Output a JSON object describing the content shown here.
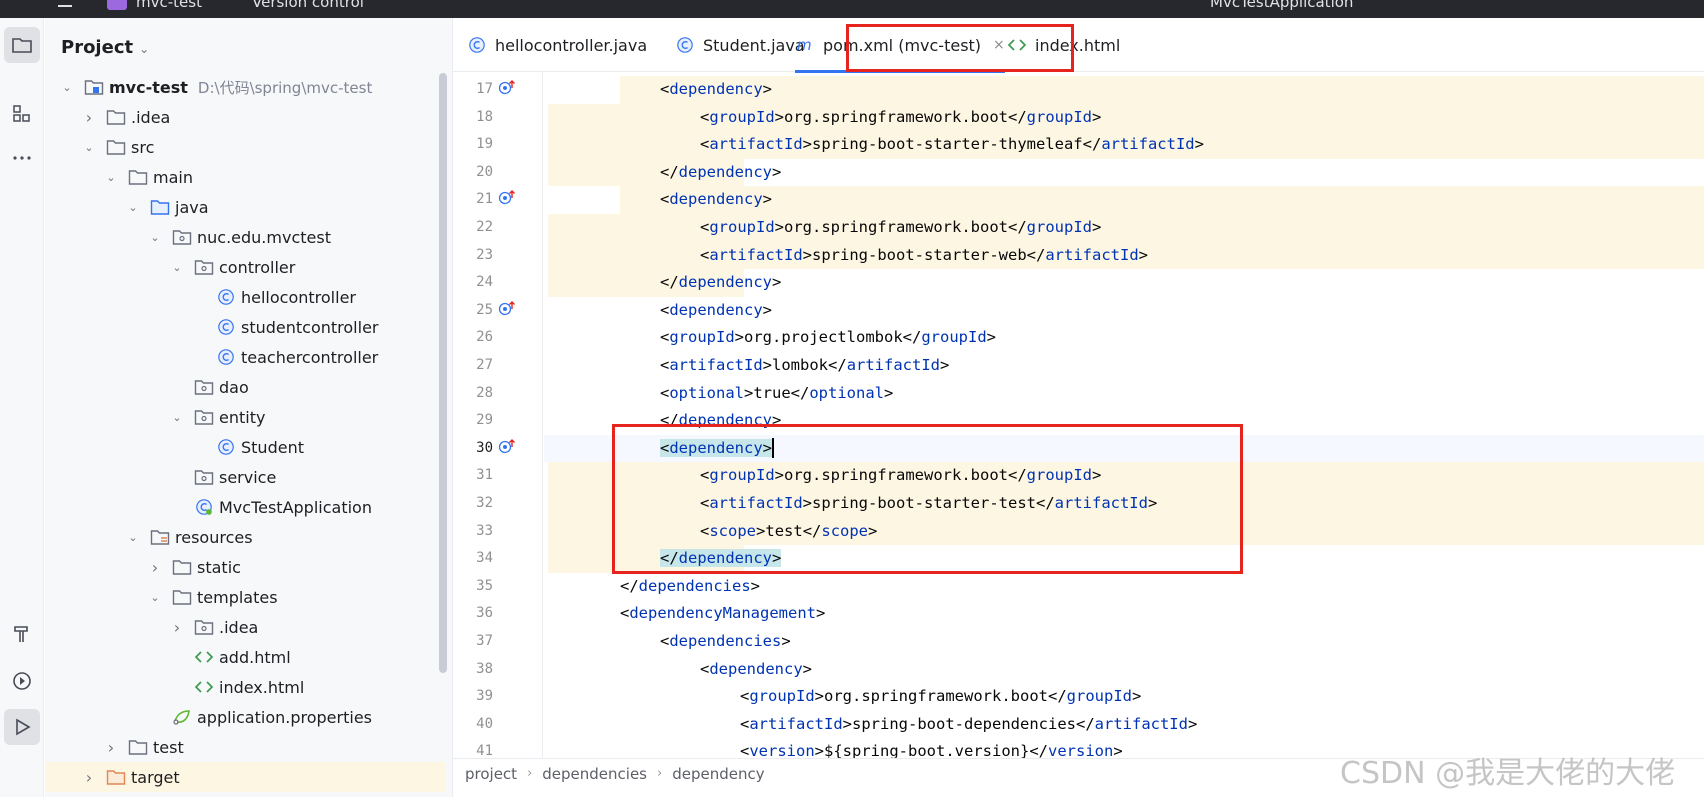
{
  "topbar": {
    "project_name": "mvc-test",
    "vcs": "Version control",
    "run_config": "MvcTestApplication"
  },
  "project_panel": {
    "title": "Project",
    "tree": [
      {
        "label": "mvc-test",
        "sub": "D:\\代码\\spring\\mvc-test",
        "icon": "module-folder-icon",
        "level": 0,
        "expanded": true,
        "bold": true
      },
      {
        "label": ".idea",
        "icon": "folder-icon",
        "level": 1,
        "expanded": false
      },
      {
        "label": "src",
        "icon": "folder-icon",
        "level": 1,
        "expanded": true
      },
      {
        "label": "main",
        "icon": "folder-icon",
        "level": 2,
        "expanded": true
      },
      {
        "label": "java",
        "icon": "source-folder-icon",
        "level": 3,
        "expanded": true
      },
      {
        "label": "nuc.edu.mvctest",
        "icon": "package-icon",
        "level": 4,
        "expanded": true
      },
      {
        "label": "controller",
        "icon": "package-icon",
        "level": 5,
        "expanded": true
      },
      {
        "label": "hellocontroller",
        "icon": "class-icon",
        "level": 6
      },
      {
        "label": "studentcontroller",
        "icon": "class-icon",
        "level": 6
      },
      {
        "label": "teachercontroller",
        "icon": "class-icon",
        "level": 6
      },
      {
        "label": "dao",
        "icon": "package-icon",
        "level": 5
      },
      {
        "label": "entity",
        "icon": "package-icon",
        "level": 5,
        "expanded": true
      },
      {
        "label": "Student",
        "icon": "class-icon",
        "level": 6
      },
      {
        "label": "service",
        "icon": "package-icon",
        "level": 5
      },
      {
        "label": "MvcTestApplication",
        "icon": "spring-class-icon",
        "level": 5
      },
      {
        "label": "resources",
        "icon": "resources-folder-icon",
        "level": 3,
        "expanded": true
      },
      {
        "label": "static",
        "icon": "folder-icon",
        "level": 4,
        "expanded": false
      },
      {
        "label": "templates",
        "icon": "folder-icon",
        "level": 4,
        "expanded": true
      },
      {
        "label": ".idea",
        "icon": "package-icon",
        "level": 5,
        "expanded": false
      },
      {
        "label": "add.html",
        "icon": "html-icon",
        "level": 5
      },
      {
        "label": "index.html",
        "icon": "html-icon",
        "level": 5
      },
      {
        "label": "application.properties",
        "icon": "properties-icon",
        "level": 4
      },
      {
        "label": "test",
        "icon": "folder-icon",
        "level": 2,
        "expanded": false
      },
      {
        "label": "target",
        "icon": "excluded-folder-icon",
        "level": 1,
        "expanded": false,
        "selected": true
      }
    ]
  },
  "tabs": [
    {
      "label": "hellocontroller.java",
      "icon": "class-icon"
    },
    {
      "label": "Student.java",
      "icon": "class-icon"
    },
    {
      "label": "pom.xml (mvc-test)",
      "icon": "maven-icon",
      "active": true,
      "close": "×"
    },
    {
      "label": "index.html",
      "icon": "html-icon"
    }
  ],
  "editor": {
    "current_line": 30,
    "lines": [
      {
        "n": 17,
        "indent": 2,
        "text": "<dependency>",
        "gutter": "override-icon"
      },
      {
        "n": 18,
        "indent": 3,
        "text": "<groupId>org.springframework.boot</groupId>"
      },
      {
        "n": 19,
        "indent": 3,
        "text": "<artifactId>spring-boot-starter-thymeleaf</artifactId>"
      },
      {
        "n": 20,
        "indent": 2,
        "text": "</dependency>"
      },
      {
        "n": 21,
        "indent": 2,
        "text": "<dependency>",
        "gutter": "override-icon"
      },
      {
        "n": 22,
        "indent": 3,
        "text": "<groupId>org.springframework.boot</groupId>"
      },
      {
        "n": 23,
        "indent": 3,
        "text": "<artifactId>spring-boot-starter-web</artifactId>"
      },
      {
        "n": 24,
        "indent": 2,
        "text": "</dependency>"
      },
      {
        "n": 25,
        "indent": 2,
        "text": "<dependency>",
        "gutter": "override-icon"
      },
      {
        "n": 26,
        "indent": 2,
        "text": "<groupId>org.projectlombok</groupId>"
      },
      {
        "n": 27,
        "indent": 2,
        "text": "<artifactId>lombok</artifactId>"
      },
      {
        "n": 28,
        "indent": 2,
        "text": "<optional>true</optional>"
      },
      {
        "n": 29,
        "indent": 2,
        "text": "</dependency>"
      },
      {
        "n": 30,
        "indent": 2,
        "text": "<dependency>",
        "gutter": "override-icon"
      },
      {
        "n": 31,
        "indent": 3,
        "text": "<groupId>org.springframework.boot</groupId>"
      },
      {
        "n": 32,
        "indent": 3,
        "text": "<artifactId>spring-boot-starter-test</artifactId>"
      },
      {
        "n": 33,
        "indent": 3,
        "text": "<scope>test</scope>"
      },
      {
        "n": 34,
        "indent": 2,
        "text": "</dependency>"
      },
      {
        "n": 35,
        "indent": 1,
        "text": "</dependencies>"
      },
      {
        "n": 36,
        "indent": 1,
        "text": "<dependencyManagement>"
      },
      {
        "n": 37,
        "indent": 2,
        "text": "<dependencies>"
      },
      {
        "n": 38,
        "indent": 3,
        "text": "<dependency>"
      },
      {
        "n": 39,
        "indent": 4,
        "text": "<groupId>org.springframework.boot</groupId>"
      },
      {
        "n": 40,
        "indent": 4,
        "text": "<artifactId>spring-boot-dependencies</artifactId>"
      },
      {
        "n": 41,
        "indent": 4,
        "text": "<version>${spring-boot.version}</version>"
      }
    ]
  },
  "breadcrumb": [
    "project",
    "dependencies",
    "dependency"
  ],
  "watermark": "CSDN @我是大佬的大佬",
  "colors": {
    "tag": "#0033b3",
    "accent": "#3574f0",
    "highlight_band": "#fdf6e3",
    "annotation_red": "#e5241d"
  }
}
